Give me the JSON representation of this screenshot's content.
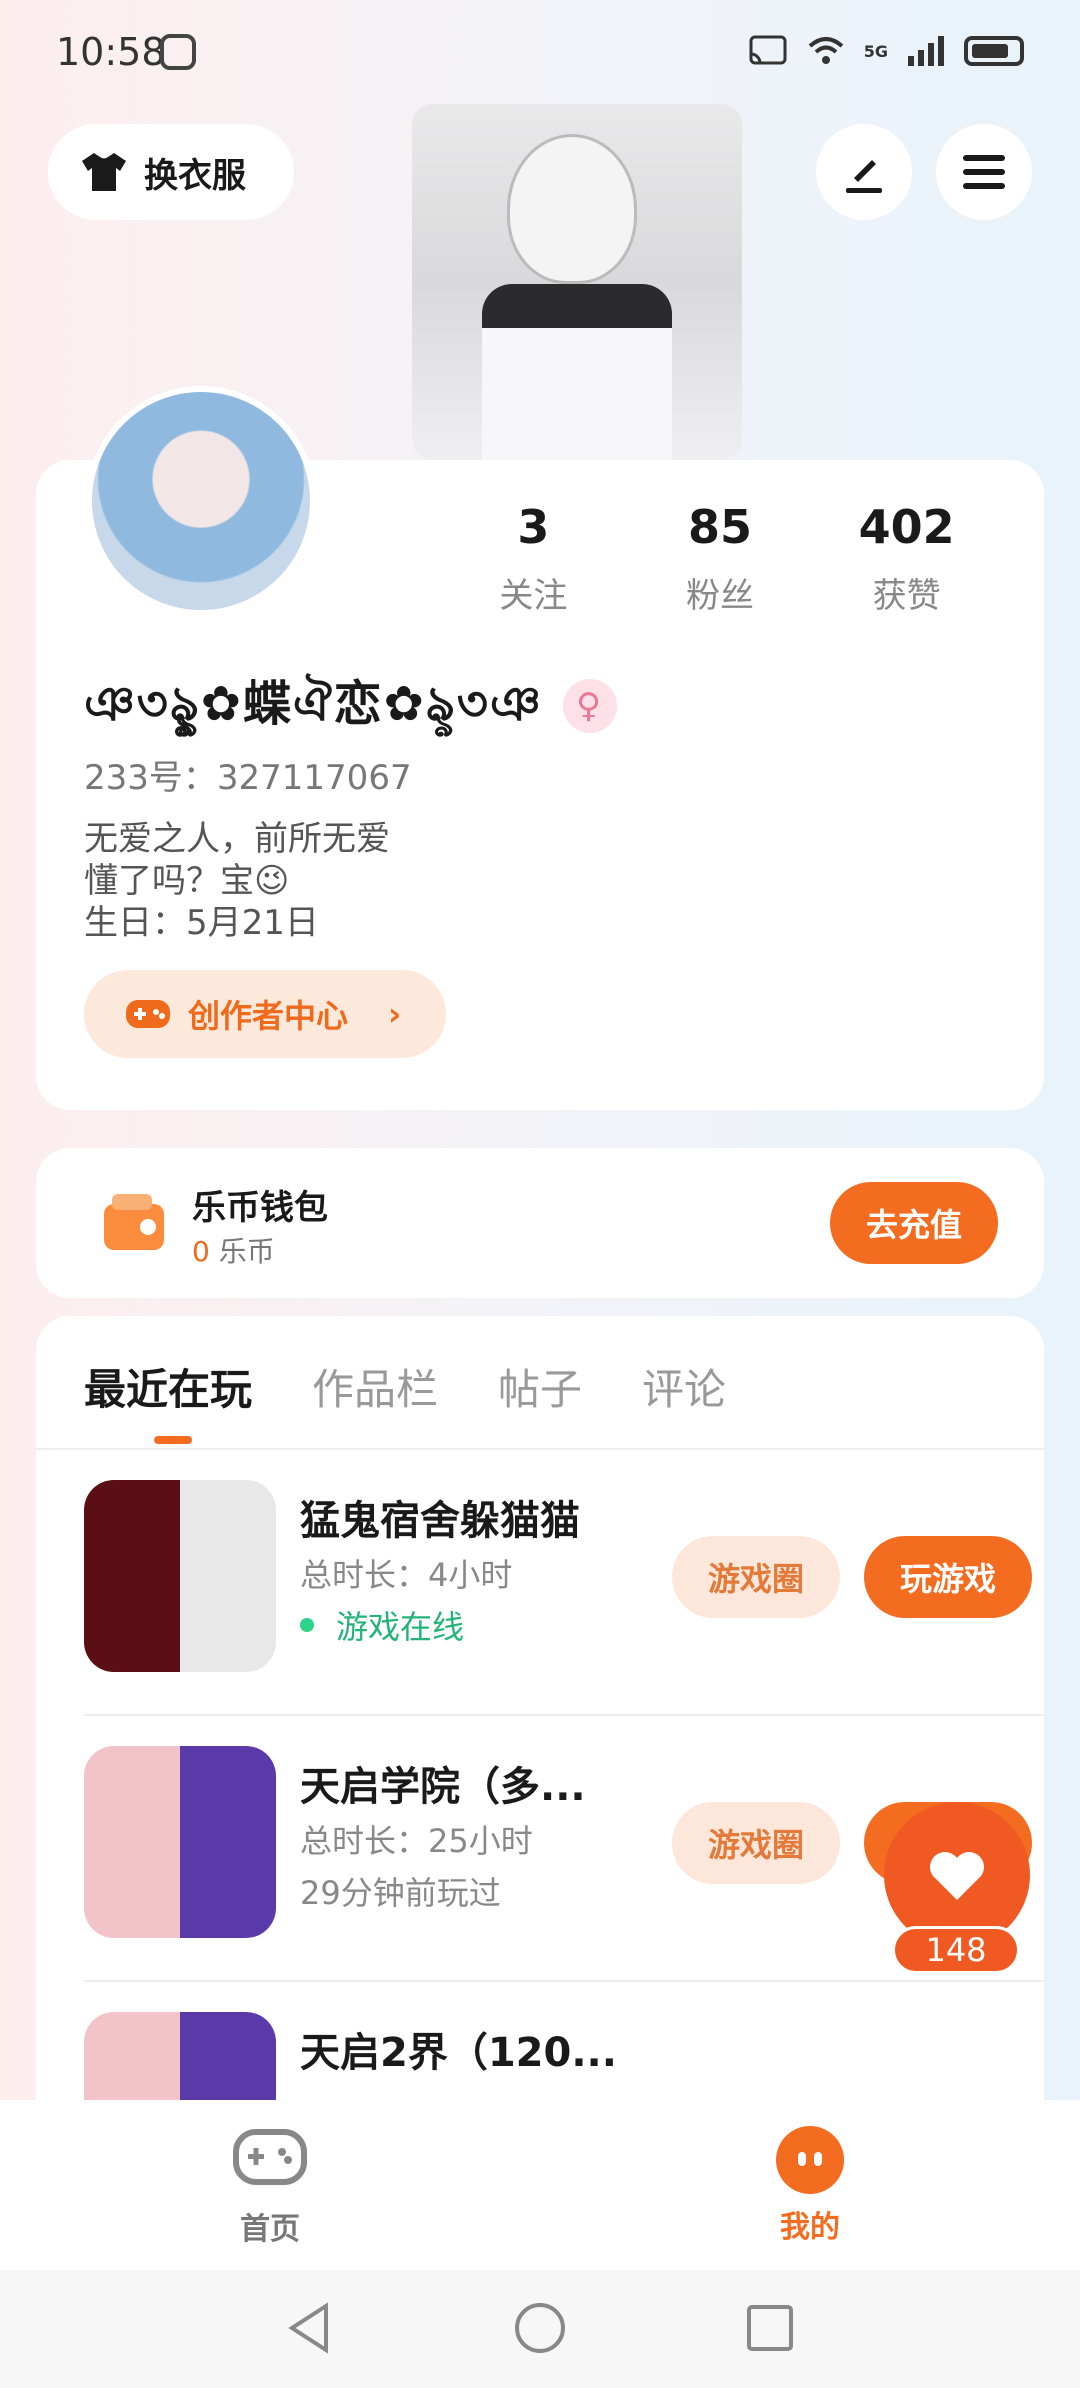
{
  "status_bar": {
    "time": "10:58",
    "network": "5G"
  },
  "header": {
    "outfit_label": "换衣服"
  },
  "profile": {
    "stats": [
      {
        "num": "3",
        "label": "关注"
      },
      {
        "num": "85",
        "label": "粉丝"
      },
      {
        "num": "402",
        "label": "获赞"
      }
    ],
    "nickname": "ঞ৩ৡৢ✿蝶ঐ恋✿ৡ৩ঞ",
    "gender_symbol": "♀",
    "uid": "233号：327117067",
    "bio": [
      "无爱之人，前所无爱",
      "懂了吗？宝😉",
      "生日：5月21日"
    ],
    "creator_center": "创作者中心"
  },
  "wallet": {
    "title": "乐币钱包",
    "balance": "0",
    "unit": "乐币",
    "recharge": "去充值"
  },
  "tabs": [
    "最近在玩",
    "作品栏",
    "帖子",
    "评论"
  ],
  "games": [
    {
      "name": "猛鬼宿舍躲猫猫",
      "time": "总时长：4小时",
      "status": "游戏在线",
      "circle": "游戏圈",
      "play": "玩游戏"
    },
    {
      "name": "天启学院（多...",
      "time": "总时长：25小时",
      "status": "29分钟前玩过",
      "circle": "游戏圈",
      "play": "玩游戏"
    },
    {
      "name": "天启2界（120...",
      "time": "",
      "status": "",
      "circle": "",
      "play": ""
    }
  ],
  "like": {
    "count": "148"
  },
  "bottom_nav": {
    "home": "首页",
    "me": "我的"
  },
  "colors": {
    "accent": "#f36c20",
    "online": "#24b47a"
  }
}
